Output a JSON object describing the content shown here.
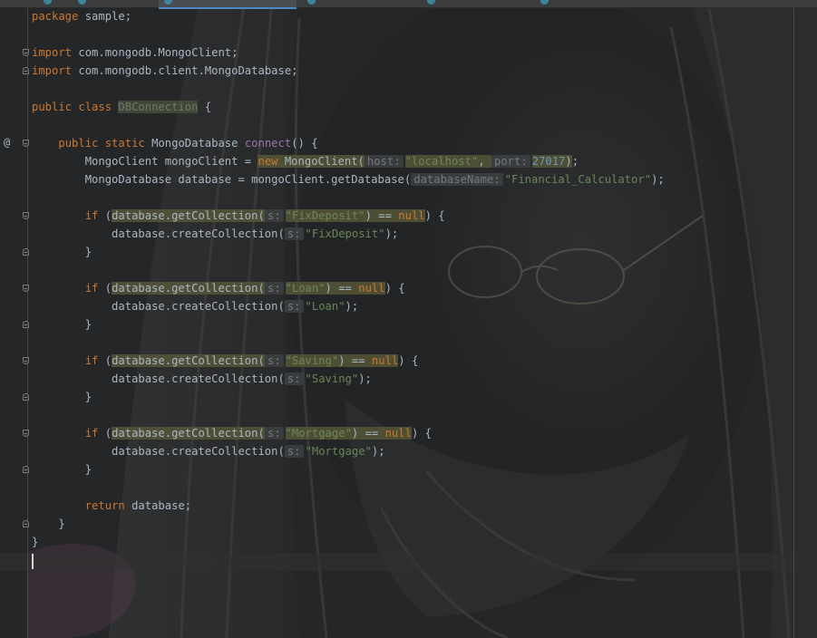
{
  "editor": {
    "gutter": {
      "override_marker": "@"
    },
    "lines": [
      {
        "tokens": [
          [
            "k",
            "package"
          ],
          [
            "p",
            " sample;"
          ]
        ]
      },
      {
        "tokens": []
      },
      {
        "tokens": [
          [
            "k",
            "import"
          ],
          [
            "p",
            " com.mongodb.MongoClient;"
          ]
        ]
      },
      {
        "tokens": [
          [
            "k",
            "import"
          ],
          [
            "p",
            " com.mongodb.client.MongoDatabase;"
          ]
        ]
      },
      {
        "tokens": []
      },
      {
        "tokens": [
          [
            "k",
            "public class "
          ],
          [
            "cls",
            "DBConnection"
          ],
          [
            "p",
            " {"
          ]
        ]
      },
      {
        "tokens": []
      },
      {
        "tokens": [
          [
            "p",
            "    "
          ],
          [
            "k",
            "public static "
          ],
          [
            "p",
            "MongoDatabase "
          ],
          [
            "g",
            "connect"
          ],
          [
            "p",
            "() {"
          ]
        ]
      },
      {
        "tokens": [
          [
            "p",
            "        MongoClient mongoClient = "
          ],
          [
            "kh",
            "new "
          ],
          [
            "ph",
            "MongoClient("
          ],
          [
            "hh",
            "host:"
          ],
          [
            "sh",
            "\"localhost\""
          ],
          [
            "ph",
            ", "
          ],
          [
            "hh",
            "port:"
          ],
          [
            "nh",
            "27017"
          ],
          [
            "ph",
            ")"
          ],
          [
            "p",
            ";"
          ]
        ]
      },
      {
        "tokens": [
          [
            "p",
            "        MongoDatabase database = mongoClient.getDatabase("
          ],
          [
            "h",
            "databaseName:"
          ],
          [
            "s",
            "\"Financial_Calculator\""
          ],
          [
            "p",
            ");"
          ]
        ]
      },
      {
        "tokens": []
      },
      {
        "tokens": [
          [
            "p",
            "        "
          ],
          [
            "k",
            "if "
          ],
          [
            "p",
            "("
          ],
          [
            "ph",
            "database.getCollection("
          ],
          [
            "hh",
            "s:"
          ],
          [
            "sh",
            "\"FixDeposit\""
          ],
          [
            "ph",
            ") == "
          ],
          [
            "kh",
            "null"
          ],
          [
            "p",
            ") {"
          ]
        ]
      },
      {
        "tokens": [
          [
            "p",
            "            database.createCollection("
          ],
          [
            "h",
            "s:"
          ],
          [
            "s",
            "\"FixDeposit\""
          ],
          [
            "p",
            ");"
          ]
        ]
      },
      {
        "tokens": [
          [
            "p",
            "        }"
          ]
        ]
      },
      {
        "tokens": []
      },
      {
        "tokens": [
          [
            "p",
            "        "
          ],
          [
            "k",
            "if "
          ],
          [
            "p",
            "("
          ],
          [
            "ph",
            "database.getCollection("
          ],
          [
            "hh",
            "s:"
          ],
          [
            "sh",
            "\"Loan\""
          ],
          [
            "ph",
            ") == "
          ],
          [
            "kh",
            "null"
          ],
          [
            "p",
            ") {"
          ]
        ]
      },
      {
        "tokens": [
          [
            "p",
            "            database.createCollection("
          ],
          [
            "h",
            "s:"
          ],
          [
            "s",
            "\"Loan\""
          ],
          [
            "p",
            ");"
          ]
        ]
      },
      {
        "tokens": [
          [
            "p",
            "        }"
          ]
        ]
      },
      {
        "tokens": []
      },
      {
        "tokens": [
          [
            "p",
            "        "
          ],
          [
            "k",
            "if "
          ],
          [
            "p",
            "("
          ],
          [
            "ph",
            "database.getCollection("
          ],
          [
            "hh",
            "s:"
          ],
          [
            "sh",
            "\"Saving\""
          ],
          [
            "ph",
            ") == "
          ],
          [
            "kh",
            "null"
          ],
          [
            "p",
            ") {"
          ]
        ]
      },
      {
        "tokens": [
          [
            "p",
            "            database.createCollection("
          ],
          [
            "h",
            "s:"
          ],
          [
            "s",
            "\"Saving\""
          ],
          [
            "p",
            ");"
          ]
        ]
      },
      {
        "tokens": [
          [
            "p",
            "        }"
          ]
        ]
      },
      {
        "tokens": []
      },
      {
        "tokens": [
          [
            "p",
            "        "
          ],
          [
            "k",
            "if "
          ],
          [
            "p",
            "("
          ],
          [
            "ph",
            "database.getCollection("
          ],
          [
            "hh",
            "s:"
          ],
          [
            "sh",
            "\"Mortgage\""
          ],
          [
            "ph",
            ") == "
          ],
          [
            "kh",
            "null"
          ],
          [
            "p",
            ") {"
          ]
        ]
      },
      {
        "tokens": [
          [
            "p",
            "            database.createCollection("
          ],
          [
            "h",
            "s:"
          ],
          [
            "s",
            "\"Mortgage\""
          ],
          [
            "p",
            ");"
          ]
        ]
      },
      {
        "tokens": [
          [
            "p",
            "        }"
          ]
        ]
      },
      {
        "tokens": []
      },
      {
        "tokens": [
          [
            "p",
            "        "
          ],
          [
            "k",
            "return "
          ],
          [
            "p",
            "database;"
          ]
        ]
      },
      {
        "tokens": [
          [
            "p",
            "    }"
          ]
        ]
      },
      {
        "tokens": [
          [
            "p",
            "}"
          ]
        ]
      },
      {
        "tokens": []
      }
    ]
  },
  "colors": {
    "background": "#252627",
    "keyword": "#cc7832",
    "string": "#6a8759",
    "number": "#6897bb",
    "default_text": "#a9b7c6",
    "param_hint": "#787878",
    "tab_accent": "#4a88c7"
  }
}
